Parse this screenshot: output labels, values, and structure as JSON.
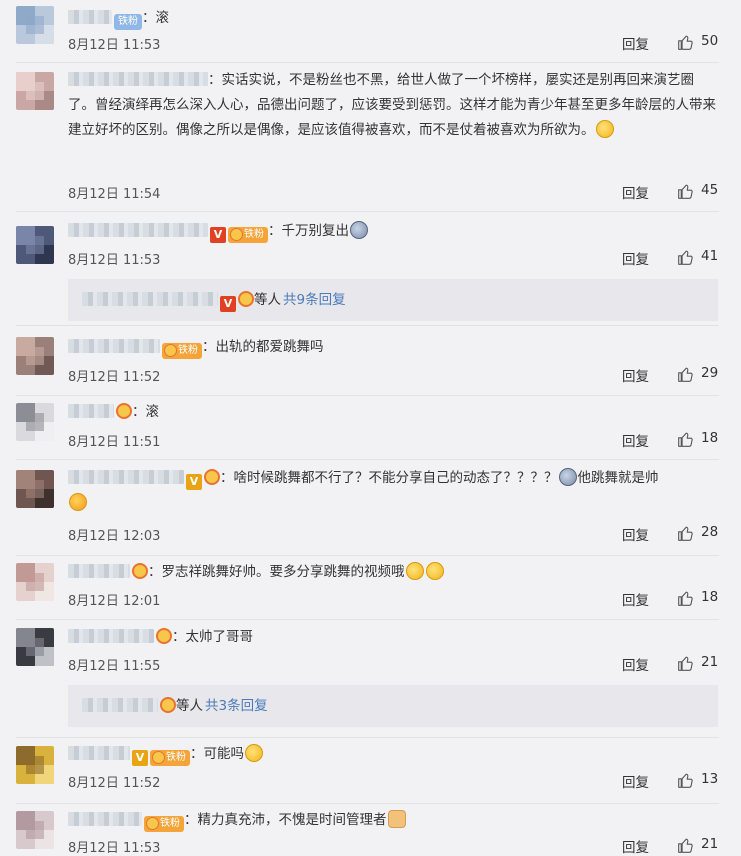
{
  "comments": [
    {
      "text": "：滚",
      "time": "8月12日 11:53",
      "reply": "回复",
      "likes": "50",
      "badge": "铁粉",
      "avatar": [
        "#b9c8dd",
        "#8fa9c9",
        "#d7dde6"
      ]
    },
    {
      "text": "：实话实说，不是粉丝也不黑，给世人做了一个坏榜样，屡实还是别再回来演艺圈了。曾经演绎再怎么深入人心，品德出问题了，应该要受到惩罚。这样才能为青少年甚至更多年龄层的人带来建立好坏的区别。偶像之所以是偶像，是应该值得被喜欢，而不是仗着被喜欢为所欲为。",
      "time": "8月12日 11:54",
      "reply": "回复",
      "likes": "45",
      "avatar": [
        "#c9a7a5",
        "#e9cfcb",
        "#a98a87"
      ]
    },
    {
      "text": "：千万别复出",
      "time": "8月12日 11:53",
      "reply": "回复",
      "likes": "41",
      "badge": "铁粉",
      "avatar": [
        "#4e5878",
        "#7a86a9",
        "#2f3650"
      ]
    },
    {
      "text": "：出轨的都爱跳舞吗",
      "time": "8月12日 11:52",
      "reply": "回复",
      "likes": "29",
      "badge": "铁粉",
      "avatar": [
        "#9b7f79",
        "#c8aaa0",
        "#715a56"
      ]
    },
    {
      "text": "：滚",
      "time": "8月12日 11:51",
      "reply": "回复",
      "likes": "18",
      "avatar": [
        "#d9d9de",
        "#8d8d95",
        "#efeff2"
      ]
    },
    {
      "text": "：啥时候跳舞都不行了？不能分享自己的动态了？？？？",
      "text2": "他跳舞就是帅",
      "time": "8月12日 12:03",
      "reply": "回复",
      "likes": "28",
      "avatar": [
        "#6f5650",
        "#a1837a",
        "#3e302d"
      ]
    },
    {
      "text": "：罗志祥跳舞好帅。要多分享跳舞的视频哦",
      "time": "8月12日 12:01",
      "reply": "回复",
      "likes": "18",
      "avatar": [
        "#e5d2cf",
        "#c29a95",
        "#f0e6e4"
      ]
    },
    {
      "text": "：太帅了哥哥",
      "time": "8月12日 11:55",
      "reply": "回复",
      "likes": "21",
      "avatar": [
        "#3a3b42",
        "#84868f",
        "#bfc1c7"
      ]
    },
    {
      "text": "：可能吗",
      "time": "8月12日 11:52",
      "reply": "回复",
      "likes": "13",
      "badge": "铁粉",
      "avatar": [
        "#d8b23d",
        "#8d6b2c",
        "#f1d57a"
      ]
    },
    {
      "text": "：精力真充沛，不愧是时间管理者",
      "time": "8月12日 11:53",
      "reply": "回复",
      "likes": "21",
      "badge": "铁粉",
      "avatar": [
        "#d7c9cc",
        "#b39aa0",
        "#ece3e5"
      ]
    }
  ],
  "sub_replies": [
    {
      "label": "等人",
      "more": "共9条回复"
    },
    {
      "label": "等人",
      "more": "共3条回复"
    }
  ]
}
